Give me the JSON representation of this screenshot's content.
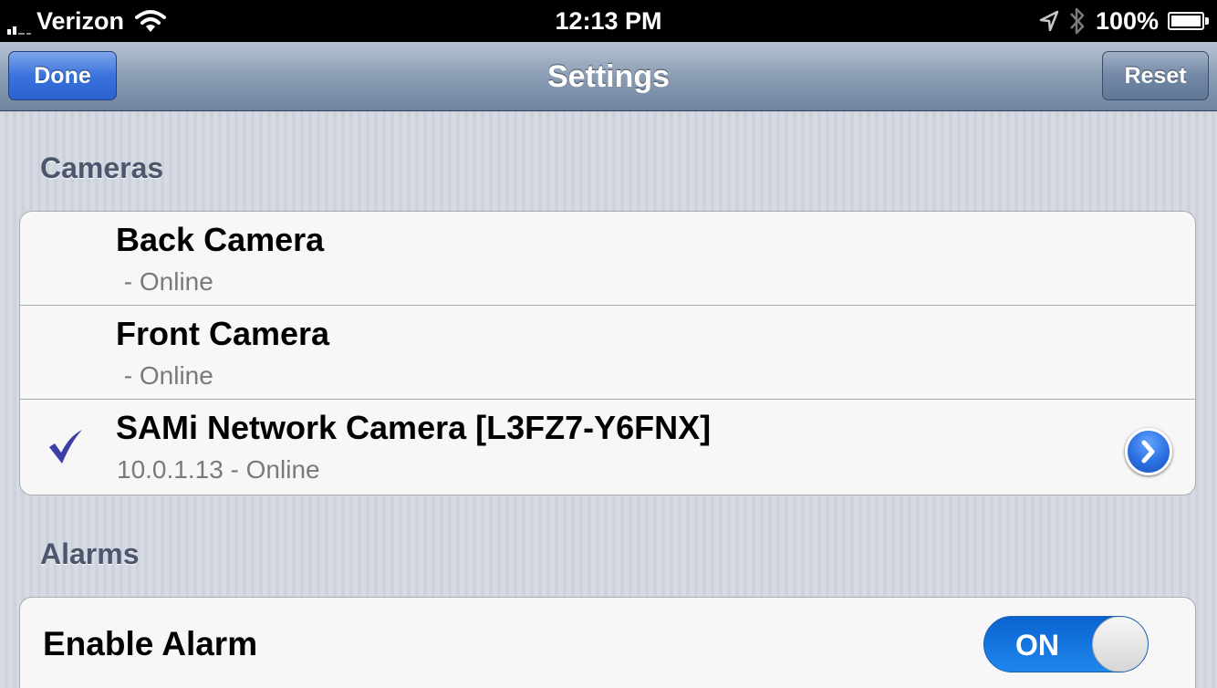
{
  "status_bar": {
    "carrier": "Verizon",
    "time": "12:13 PM",
    "battery_percent": "100%"
  },
  "nav_bar": {
    "done_label": "Done",
    "title": "Settings",
    "reset_label": "Reset"
  },
  "cameras": {
    "header": "Cameras",
    "items": [
      {
        "name": "Back Camera",
        "status": " - Online",
        "selected": false
      },
      {
        "name": "Front Camera",
        "status": " - Online",
        "selected": false
      },
      {
        "name": "SAMi Network Camera [L3FZ7-Y6FNX]",
        "status": "10.0.1.13 - Online",
        "selected": true
      }
    ]
  },
  "alarms": {
    "header": "Alarms",
    "enable_alarm_label": "Enable Alarm",
    "toggle_label": "ON",
    "enabled": true
  },
  "colors": {
    "accent_blue": "#2b6fe0",
    "checkmark": "#3b3fa6"
  },
  "icons": [
    "signal-icon",
    "wifi-icon",
    "location-arrow-icon",
    "bluetooth-icon",
    "battery-icon",
    "checkmark-icon",
    "disclosure-chevron-icon"
  ]
}
